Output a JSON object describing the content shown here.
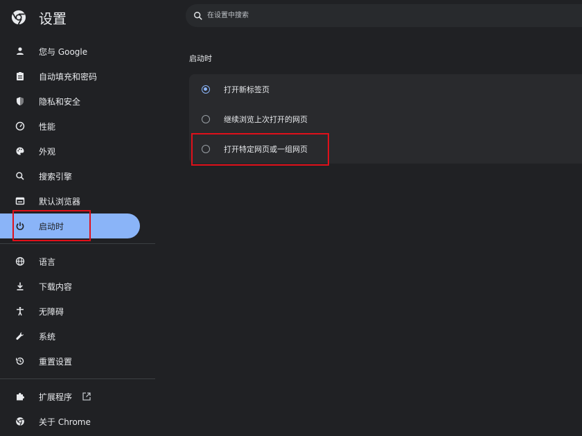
{
  "header": {
    "title": "设置",
    "search_placeholder": "在设置中搜索"
  },
  "sidebar": {
    "items": [
      {
        "label": "您与 Google",
        "icon": "person-icon"
      },
      {
        "label": "自动填充和密码",
        "icon": "clipboard-icon"
      },
      {
        "label": "隐私和安全",
        "icon": "shield-icon"
      },
      {
        "label": "性能",
        "icon": "speedometer-icon"
      },
      {
        "label": "外观",
        "icon": "palette-icon"
      },
      {
        "label": "搜索引擎",
        "icon": "search-icon"
      },
      {
        "label": "默认浏览器",
        "icon": "browser-icon"
      },
      {
        "label": "启动时",
        "icon": "power-icon",
        "active": true
      },
      {
        "label": "语言",
        "icon": "globe-icon"
      },
      {
        "label": "下载内容",
        "icon": "download-icon"
      },
      {
        "label": "无障碍",
        "icon": "accessibility-icon"
      },
      {
        "label": "系统",
        "icon": "wrench-icon"
      },
      {
        "label": "重置设置",
        "icon": "history-icon"
      },
      {
        "label": "扩展程序",
        "icon": "puzzle-icon"
      },
      {
        "label": "关于 Chrome",
        "icon": "chrome-icon"
      }
    ]
  },
  "main": {
    "section_title": "启动时",
    "options": [
      {
        "label": "打开新标签页",
        "checked": true
      },
      {
        "label": "继续浏览上次打开的网页",
        "checked": false
      },
      {
        "label": "打开特定网页或一组网页",
        "checked": false
      }
    ]
  },
  "colors": {
    "background": "#202124",
    "accent": "#8ab4f8",
    "highlight": "#e0101a"
  }
}
